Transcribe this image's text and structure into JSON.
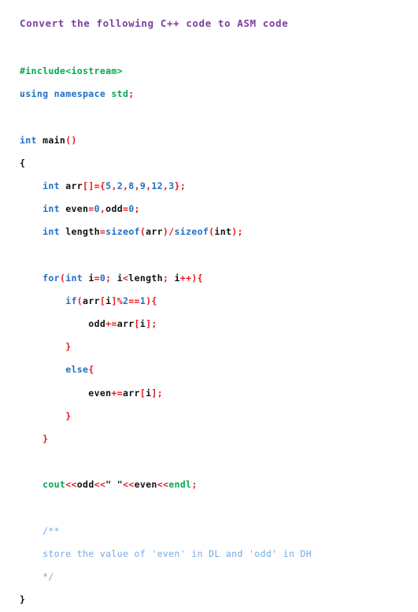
{
  "prompt": {
    "title": "Convert the following C++ code to ASM code",
    "color": "#7b3fa0"
  },
  "palette": {
    "keyword": "#1f6fc4",
    "number": "#1f6fc4",
    "operator": "#e8191b",
    "identifier": "#111111",
    "preprocessor": "#00a84f",
    "stdlib": "#00a84f",
    "string": "#111111",
    "comment": "#74a9e0",
    "background": "#ffffff"
  },
  "code": {
    "language": "C++",
    "lines": [
      {
        "indent": 0,
        "tokens": [
          {
            "t": "#include<iostream>",
            "c": "pre"
          }
        ]
      },
      {
        "indent": 0,
        "tokens": [
          {
            "t": "using",
            "c": "kw"
          },
          {
            "t": " ",
            "c": "plain"
          },
          {
            "t": "namespace",
            "c": "kw"
          },
          {
            "t": " ",
            "c": "plain"
          },
          {
            "t": "std",
            "c": "std"
          },
          {
            "t": ";",
            "c": "op"
          }
        ]
      },
      {
        "indent": 0,
        "tokens": []
      },
      {
        "indent": 0,
        "tokens": [
          {
            "t": "int",
            "c": "kw"
          },
          {
            "t": " ",
            "c": "plain"
          },
          {
            "t": "main",
            "c": "id"
          },
          {
            "t": "()",
            "c": "op"
          }
        ]
      },
      {
        "indent": 0,
        "tokens": [
          {
            "t": "{",
            "c": "plain"
          }
        ]
      },
      {
        "indent": 4,
        "tokens": [
          {
            "t": "int",
            "c": "kw"
          },
          {
            "t": " ",
            "c": "plain"
          },
          {
            "t": "arr",
            "c": "id"
          },
          {
            "t": "[]=",
            "c": "op"
          },
          {
            "t": "{",
            "c": "op"
          },
          {
            "t": "5",
            "c": "num"
          },
          {
            "t": ",",
            "c": "op"
          },
          {
            "t": "2",
            "c": "num"
          },
          {
            "t": ",",
            "c": "op"
          },
          {
            "t": "8",
            "c": "num"
          },
          {
            "t": ",",
            "c": "op"
          },
          {
            "t": "9",
            "c": "num"
          },
          {
            "t": ",",
            "c": "op"
          },
          {
            "t": "12",
            "c": "num"
          },
          {
            "t": ",",
            "c": "op"
          },
          {
            "t": "3",
            "c": "num"
          },
          {
            "t": "}",
            "c": "op"
          },
          {
            "t": ";",
            "c": "op"
          }
        ]
      },
      {
        "indent": 4,
        "tokens": [
          {
            "t": "int",
            "c": "kw"
          },
          {
            "t": " ",
            "c": "plain"
          },
          {
            "t": "even",
            "c": "id"
          },
          {
            "t": "=",
            "c": "op"
          },
          {
            "t": "0",
            "c": "num"
          },
          {
            "t": ",",
            "c": "op"
          },
          {
            "t": "odd",
            "c": "id"
          },
          {
            "t": "=",
            "c": "op"
          },
          {
            "t": "0",
            "c": "num"
          },
          {
            "t": ";",
            "c": "op"
          }
        ]
      },
      {
        "indent": 4,
        "tokens": [
          {
            "t": "int",
            "c": "kw"
          },
          {
            "t": " ",
            "c": "plain"
          },
          {
            "t": "length",
            "c": "id"
          },
          {
            "t": "=",
            "c": "op"
          },
          {
            "t": "sizeof",
            "c": "kw"
          },
          {
            "t": "(",
            "c": "op"
          },
          {
            "t": "arr",
            "c": "id"
          },
          {
            "t": ")",
            "c": "op"
          },
          {
            "t": "/",
            "c": "op"
          },
          {
            "t": "sizeof",
            "c": "kw"
          },
          {
            "t": "(",
            "c": "op"
          },
          {
            "t": "int",
            "c": "id"
          },
          {
            "t": ")",
            "c": "op"
          },
          {
            "t": ";",
            "c": "op"
          }
        ]
      },
      {
        "indent": 0,
        "tokens": []
      },
      {
        "indent": 4,
        "tokens": [
          {
            "t": "for",
            "c": "kw"
          },
          {
            "t": "(",
            "c": "op"
          },
          {
            "t": "int",
            "c": "kw"
          },
          {
            "t": " ",
            "c": "plain"
          },
          {
            "t": "i",
            "c": "id"
          },
          {
            "t": "=",
            "c": "op"
          },
          {
            "t": "0",
            "c": "num"
          },
          {
            "t": ";",
            "c": "op"
          },
          {
            "t": " ",
            "c": "plain"
          },
          {
            "t": "i",
            "c": "id"
          },
          {
            "t": "<",
            "c": "op"
          },
          {
            "t": "length",
            "c": "id"
          },
          {
            "t": ";",
            "c": "op"
          },
          {
            "t": " ",
            "c": "plain"
          },
          {
            "t": "i",
            "c": "id"
          },
          {
            "t": "++",
            "c": "op"
          },
          {
            "t": ")",
            "c": "op"
          },
          {
            "t": "{",
            "c": "op"
          }
        ]
      },
      {
        "indent": 8,
        "tokens": [
          {
            "t": "if",
            "c": "kw"
          },
          {
            "t": "(",
            "c": "op"
          },
          {
            "t": "arr",
            "c": "id"
          },
          {
            "t": "[",
            "c": "op"
          },
          {
            "t": "i",
            "c": "id"
          },
          {
            "t": "]",
            "c": "op"
          },
          {
            "t": "%",
            "c": "op"
          },
          {
            "t": "2",
            "c": "num"
          },
          {
            "t": "==",
            "c": "op"
          },
          {
            "t": "1",
            "c": "num"
          },
          {
            "t": ")",
            "c": "op"
          },
          {
            "t": "{",
            "c": "op"
          }
        ]
      },
      {
        "indent": 12,
        "tokens": [
          {
            "t": "odd",
            "c": "id"
          },
          {
            "t": "+=",
            "c": "op"
          },
          {
            "t": "arr",
            "c": "id"
          },
          {
            "t": "[",
            "c": "op"
          },
          {
            "t": "i",
            "c": "id"
          },
          {
            "t": "]",
            "c": "op"
          },
          {
            "t": ";",
            "c": "op"
          }
        ]
      },
      {
        "indent": 8,
        "tokens": [
          {
            "t": "}",
            "c": "op"
          }
        ]
      },
      {
        "indent": 8,
        "tokens": [
          {
            "t": "else",
            "c": "kw"
          },
          {
            "t": "{",
            "c": "op"
          }
        ]
      },
      {
        "indent": 12,
        "tokens": [
          {
            "t": "even",
            "c": "id"
          },
          {
            "t": "+=",
            "c": "op"
          },
          {
            "t": "arr",
            "c": "id"
          },
          {
            "t": "[",
            "c": "op"
          },
          {
            "t": "i",
            "c": "id"
          },
          {
            "t": "]",
            "c": "op"
          },
          {
            "t": ";",
            "c": "op"
          }
        ]
      },
      {
        "indent": 8,
        "tokens": [
          {
            "t": "}",
            "c": "op"
          }
        ]
      },
      {
        "indent": 4,
        "tokens": [
          {
            "t": "}",
            "c": "op"
          }
        ]
      },
      {
        "indent": 0,
        "tokens": []
      },
      {
        "indent": 4,
        "tokens": [
          {
            "t": "cout",
            "c": "std"
          },
          {
            "t": "<<",
            "c": "op"
          },
          {
            "t": "odd",
            "c": "id"
          },
          {
            "t": "<<",
            "c": "op"
          },
          {
            "t": "\" \"",
            "c": "str"
          },
          {
            "t": "<<",
            "c": "op"
          },
          {
            "t": "even",
            "c": "id"
          },
          {
            "t": "<<",
            "c": "op"
          },
          {
            "t": "endl",
            "c": "std"
          },
          {
            "t": ";",
            "c": "op"
          }
        ]
      },
      {
        "indent": 0,
        "tokens": []
      },
      {
        "indent": 4,
        "tokens": [
          {
            "t": "/**",
            "c": "com"
          }
        ]
      },
      {
        "indent": 4,
        "tokens": [
          {
            "t": "store the value of 'even' in DL and 'odd' in DH",
            "c": "com"
          }
        ]
      },
      {
        "indent": 4,
        "tokens": [
          {
            "t": "*/",
            "c": "com"
          }
        ]
      },
      {
        "indent": 0,
        "tokens": [
          {
            "t": "}",
            "c": "plain"
          }
        ]
      }
    ]
  }
}
